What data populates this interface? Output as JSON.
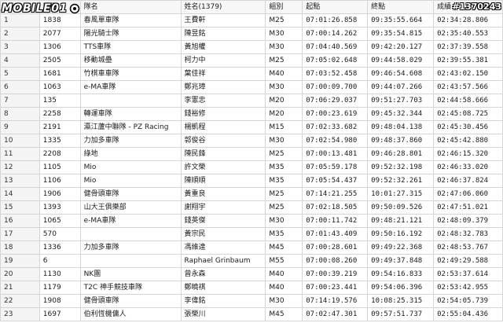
{
  "brand": {
    "logo_text": "MOBILE01",
    "watermark": "#1370243"
  },
  "headers": [
    "",
    "號碼",
    "隊名",
    "姓名(1379)",
    "組別",
    "起點",
    "終點",
    "成績"
  ],
  "rows": [
    [
      "1",
      "1838",
      "春風單車隊",
      "王費軒",
      "M25",
      "07:01:26.858",
      "09:35:55.664",
      "02:34:28.806"
    ],
    [
      "2",
      "2077",
      "陽光騎士隊",
      "陳昱銘",
      "M30",
      "07:00:14.262",
      "09:35:54.815",
      "02:35:40.553"
    ],
    [
      "3",
      "1306",
      "TTS車隊",
      "黃旭權",
      "M30",
      "07:04:40.569",
      "09:42:20.127",
      "02:37:39.558"
    ],
    [
      "4",
      "2505",
      "移動城壘",
      "柯力中",
      "M25",
      "07:05:02.648",
      "09:44:58.029",
      "02:39:55.381"
    ],
    [
      "5",
      "1681",
      "竹棋車車隊",
      "葉佳祥",
      "M40",
      "07:03:52.458",
      "09:46:54.608",
      "02:43:02.150"
    ],
    [
      "6",
      "1063",
      "e-MA車隊",
      "鄭兆璋",
      "M30",
      "07:00:09.700",
      "09:44:07.266",
      "02:43:57.566"
    ],
    [
      "7",
      "135",
      "",
      "李憲忠",
      "M20",
      "07:06:29.037",
      "09:51:27.703",
      "02:44:58.666"
    ],
    [
      "8",
      "2258",
      "轉運車隊",
      "錢裕修",
      "M20",
      "07:00:23.619",
      "09:45:32.344",
      "02:45:08.725"
    ],
    [
      "9",
      "2191",
      "瀛江蘆中聯隊 - PZ Racing",
      "楊凱程",
      "M15",
      "07:02:33.682",
      "09:48:04.138",
      "02:45:30.456"
    ],
    [
      "10",
      "1335",
      "力加多車隊",
      "郭俊谷",
      "M30",
      "07:02:54.980",
      "09:48:37.860",
      "02:45:42.880"
    ],
    [
      "11",
      "2208",
      "綠地",
      "陳民鋒",
      "M25",
      "07:00:13.481",
      "09:46:28.801",
      "02:46:15.320"
    ],
    [
      "12",
      "1105",
      "Mio",
      "許文榮",
      "M35",
      "07:05:59.178",
      "09:52:32.198",
      "02:46:33.020"
    ],
    [
      "13",
      "1106",
      "Mio",
      "陳順順",
      "M35",
      "07:05:54.437",
      "09:52:32.261",
      "02:46:37.824"
    ],
    [
      "14",
      "1906",
      "健骨頭車隊",
      "黃重良",
      "M25",
      "07:14:21.255",
      "10:01:27.315",
      "02:47:06.060"
    ],
    [
      "15",
      "1393",
      "山大王俱樂部",
      "謝翔宇",
      "M25",
      "07:02:18.505",
      "09:50:09.526",
      "02:47:51.021"
    ],
    [
      "16",
      "1065",
      "e-MA車隊",
      "錢英傑",
      "M30",
      "07:00:11.742",
      "09:48:21.121",
      "02:48:09.379"
    ],
    [
      "17",
      "570",
      "",
      "黃宗民",
      "M35",
      "07:01:43.409",
      "09:50:16.192",
      "02:48:32.783"
    ],
    [
      "18",
      "1336",
      "力加多車隊",
      "馮維達",
      "M45",
      "07:00:28.601",
      "09:49:22.368",
      "02:48:53.767"
    ],
    [
      "19",
      "6",
      "",
      "Raphael Grinbaum",
      "M55",
      "07:00:08.260",
      "09:49:37.848",
      "02:49:29.588"
    ],
    [
      "20",
      "1130",
      "NK團",
      "曾永森",
      "M40",
      "07:00:39.219",
      "09:54:16.833",
      "02:53:37.614"
    ],
    [
      "21",
      "1179",
      "T2C 神手競技車隊",
      "鄭曉祺",
      "M40",
      "07:00:23.441",
      "09:54:06.396",
      "02:53:42.955"
    ],
    [
      "22",
      "1908",
      "健骨頭車隊",
      "李偉銘",
      "M30",
      "07:14:19.576",
      "10:08:25.315",
      "02:54:05.739"
    ],
    [
      "23",
      "1697",
      "伯利恆機傭人",
      "張榮川",
      "M45",
      "07:02:47.301",
      "09:57:51.737",
      "02:55:04.436"
    ]
  ]
}
